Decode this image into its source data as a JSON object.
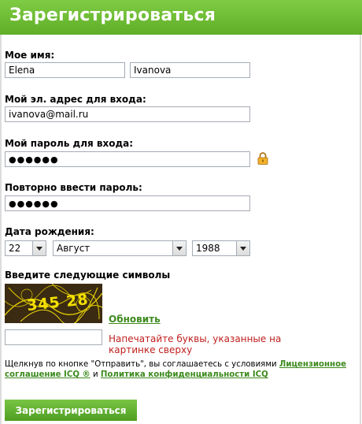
{
  "header": {
    "title": "Зарегистрироваться"
  },
  "form": {
    "name_label": "Мое имя:",
    "first_name": "Elena",
    "last_name": "Ivanova",
    "email_label": "Мой эл. адрес для входа:",
    "email": "ivanova@mail.ru",
    "password_label": "Мой пароль для входа:",
    "password_mask": "●●●●●●",
    "repeat_label": "Повторно ввести пароль:",
    "repeat_mask": "●●●●●●",
    "birth_label": "Дата рождения:",
    "birth_day": "22",
    "birth_month": "Август",
    "birth_year": "1988",
    "captcha_label": "Введите следующие символы",
    "captcha_text": "345 28",
    "refresh_label": "Обновить",
    "captcha_input": "",
    "captcha_hint": "Напечатайте буквы, указанные на картинке сверху",
    "terms_prefix": "Щелкнув по кнопке \"Отправить\", вы соглашаетесь с условиями ",
    "terms_link1": "Лицензионное соглашение ICQ ®",
    "terms_and": " и ",
    "terms_link2": "Политика конфиденциальности ICQ",
    "submit_label": "Зарегистрироваться"
  },
  "colors": {
    "header_green": "#6dbd35",
    "link_green": "#3d8a1e",
    "hint_red": "#c0201f"
  },
  "icons": [
    "lock-icon",
    "dropdown-arrow-icon"
  ]
}
